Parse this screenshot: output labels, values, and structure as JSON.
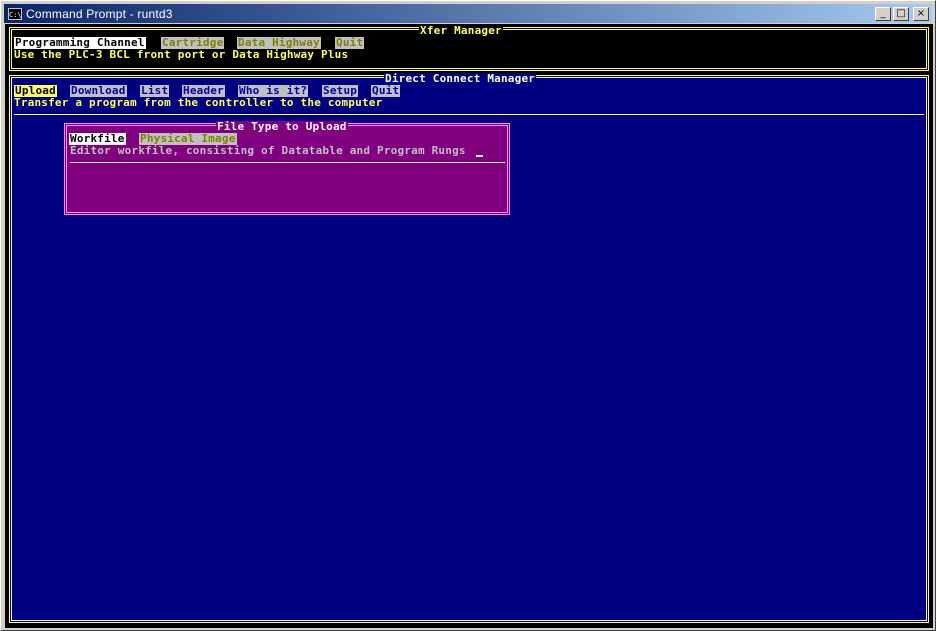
{
  "window": {
    "title": "Command Prompt - runtd3",
    "icon_text": "C:\\"
  },
  "colors": {
    "xfer_bg": "#000000",
    "xfer_fg": "#ffff55",
    "dcm_bg": "#000080",
    "dialog_bg": "#800080",
    "selected_bg": "#ffffff",
    "selected_fg": "#000000",
    "inactive_bg": "#c0c0c0",
    "inactive_fg": "#808000"
  },
  "xfer": {
    "title": "Xfer Manager",
    "menu": [
      "Programming Channel",
      "Cartridge",
      "Data Highway",
      "Quit"
    ],
    "selected_index": 0,
    "description": "Use the PLC-3 BCL front port or Data Highway Plus"
  },
  "dcm": {
    "title": "Direct Connect Manager",
    "menu": [
      "Upload",
      "Download",
      "List",
      "Header",
      "Who is it?",
      "Setup",
      "Quit"
    ],
    "selected_index": 0,
    "description": "Transfer a program from the controller to the computer"
  },
  "dialog": {
    "title": "File Type to Upload",
    "options": [
      "Workfile",
      "Physical Image"
    ],
    "selected_index": 0,
    "description": "Editor workfile, consisting of Datatable and Program Rungs"
  },
  "controls": {
    "minimize": "_",
    "maximize": "□",
    "close": "×"
  }
}
